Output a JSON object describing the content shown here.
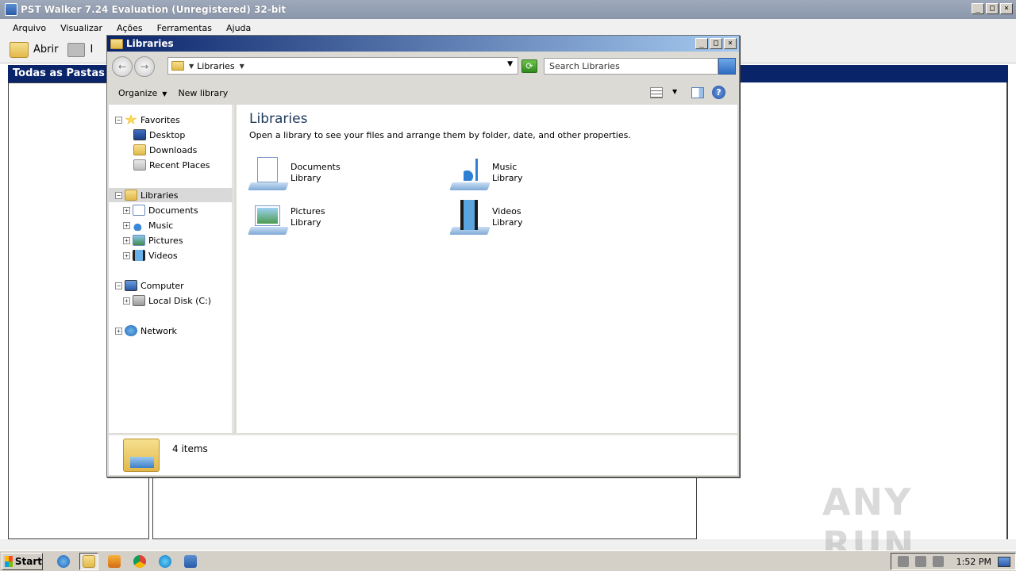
{
  "bg_app": {
    "title": "PST Walker 7.24 Evaluation (Unregistered) 32-bit",
    "menu": [
      "Arquivo",
      "Visualizar",
      "Ações",
      "Ferramentas",
      "Ajuda"
    ],
    "toolbar_open": "Abrir",
    "toolbar_print": "I",
    "panel_header": "Todas as Pastas"
  },
  "explorer": {
    "title": "Libraries",
    "address": "Libraries",
    "search_placeholder": "Search Libraries",
    "cmd_organize": "Organize",
    "cmd_new_library": "New library",
    "nav": {
      "favorites": "Favorites",
      "desktop": "Desktop",
      "downloads": "Downloads",
      "recent": "Recent Places",
      "libraries": "Libraries",
      "documents": "Documents",
      "music": "Music",
      "pictures": "Pictures",
      "videos": "Videos",
      "computer": "Computer",
      "local_disk": "Local Disk (C:)",
      "network": "Network"
    },
    "content": {
      "title": "Libraries",
      "description": "Open a library to see your files and arrange them by folder, date, and other properties.",
      "items": [
        {
          "name": "Documents",
          "type": "Library"
        },
        {
          "name": "Music",
          "type": "Library"
        },
        {
          "name": "Pictures",
          "type": "Library"
        },
        {
          "name": "Videos",
          "type": "Library"
        }
      ]
    },
    "status": "4 items"
  },
  "watermark": "ANY RUN",
  "taskbar": {
    "start": "Start",
    "clock": "1:52 PM"
  }
}
